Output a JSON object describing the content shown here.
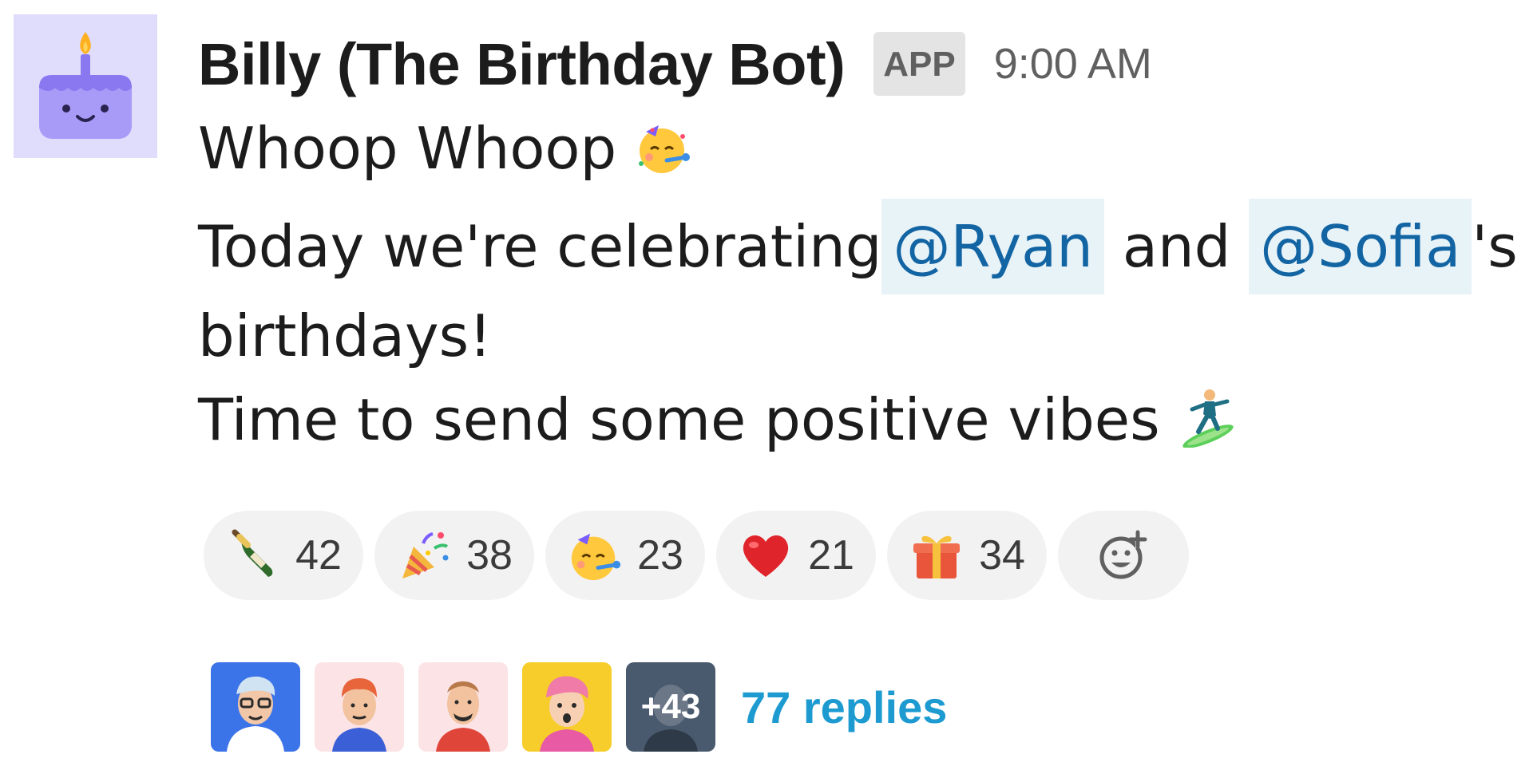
{
  "message": {
    "sender": "Billy (The Birthday Bot)",
    "badge": "APP",
    "timestamp": "9:00 AM",
    "line1_text": "Whoop Whoop ",
    "line1_emoji": "partying-face",
    "line2_prefix": "Today we're celebrating",
    "mention1": "@Ryan",
    "line2_mid": " and ",
    "mention2": "@Sofia",
    "line2_suffix": "'s",
    "line3_text": "birthdays!",
    "line4_text": "Time to send some positive vibes ",
    "line4_emoji": "surfer"
  },
  "reactions": [
    {
      "icon": "champagne-bottle-icon",
      "count": "42"
    },
    {
      "icon": "party-popper-icon",
      "count": "38"
    },
    {
      "icon": "partying-face-icon",
      "count": "23"
    },
    {
      "icon": "red-heart-icon",
      "count": "21"
    },
    {
      "icon": "gift-icon",
      "count": "34"
    }
  ],
  "add_reaction_icon": "add-reaction-icon",
  "thread": {
    "more_participants": "+43",
    "replies_label": "77 replies"
  },
  "colors": {
    "mention_bg": "#e8f3f8",
    "mention_text": "#1264a3",
    "replies_link": "#1d9bd1",
    "avatar_bg": "#e0dcfc",
    "reaction_bg": "#f2f2f2"
  }
}
